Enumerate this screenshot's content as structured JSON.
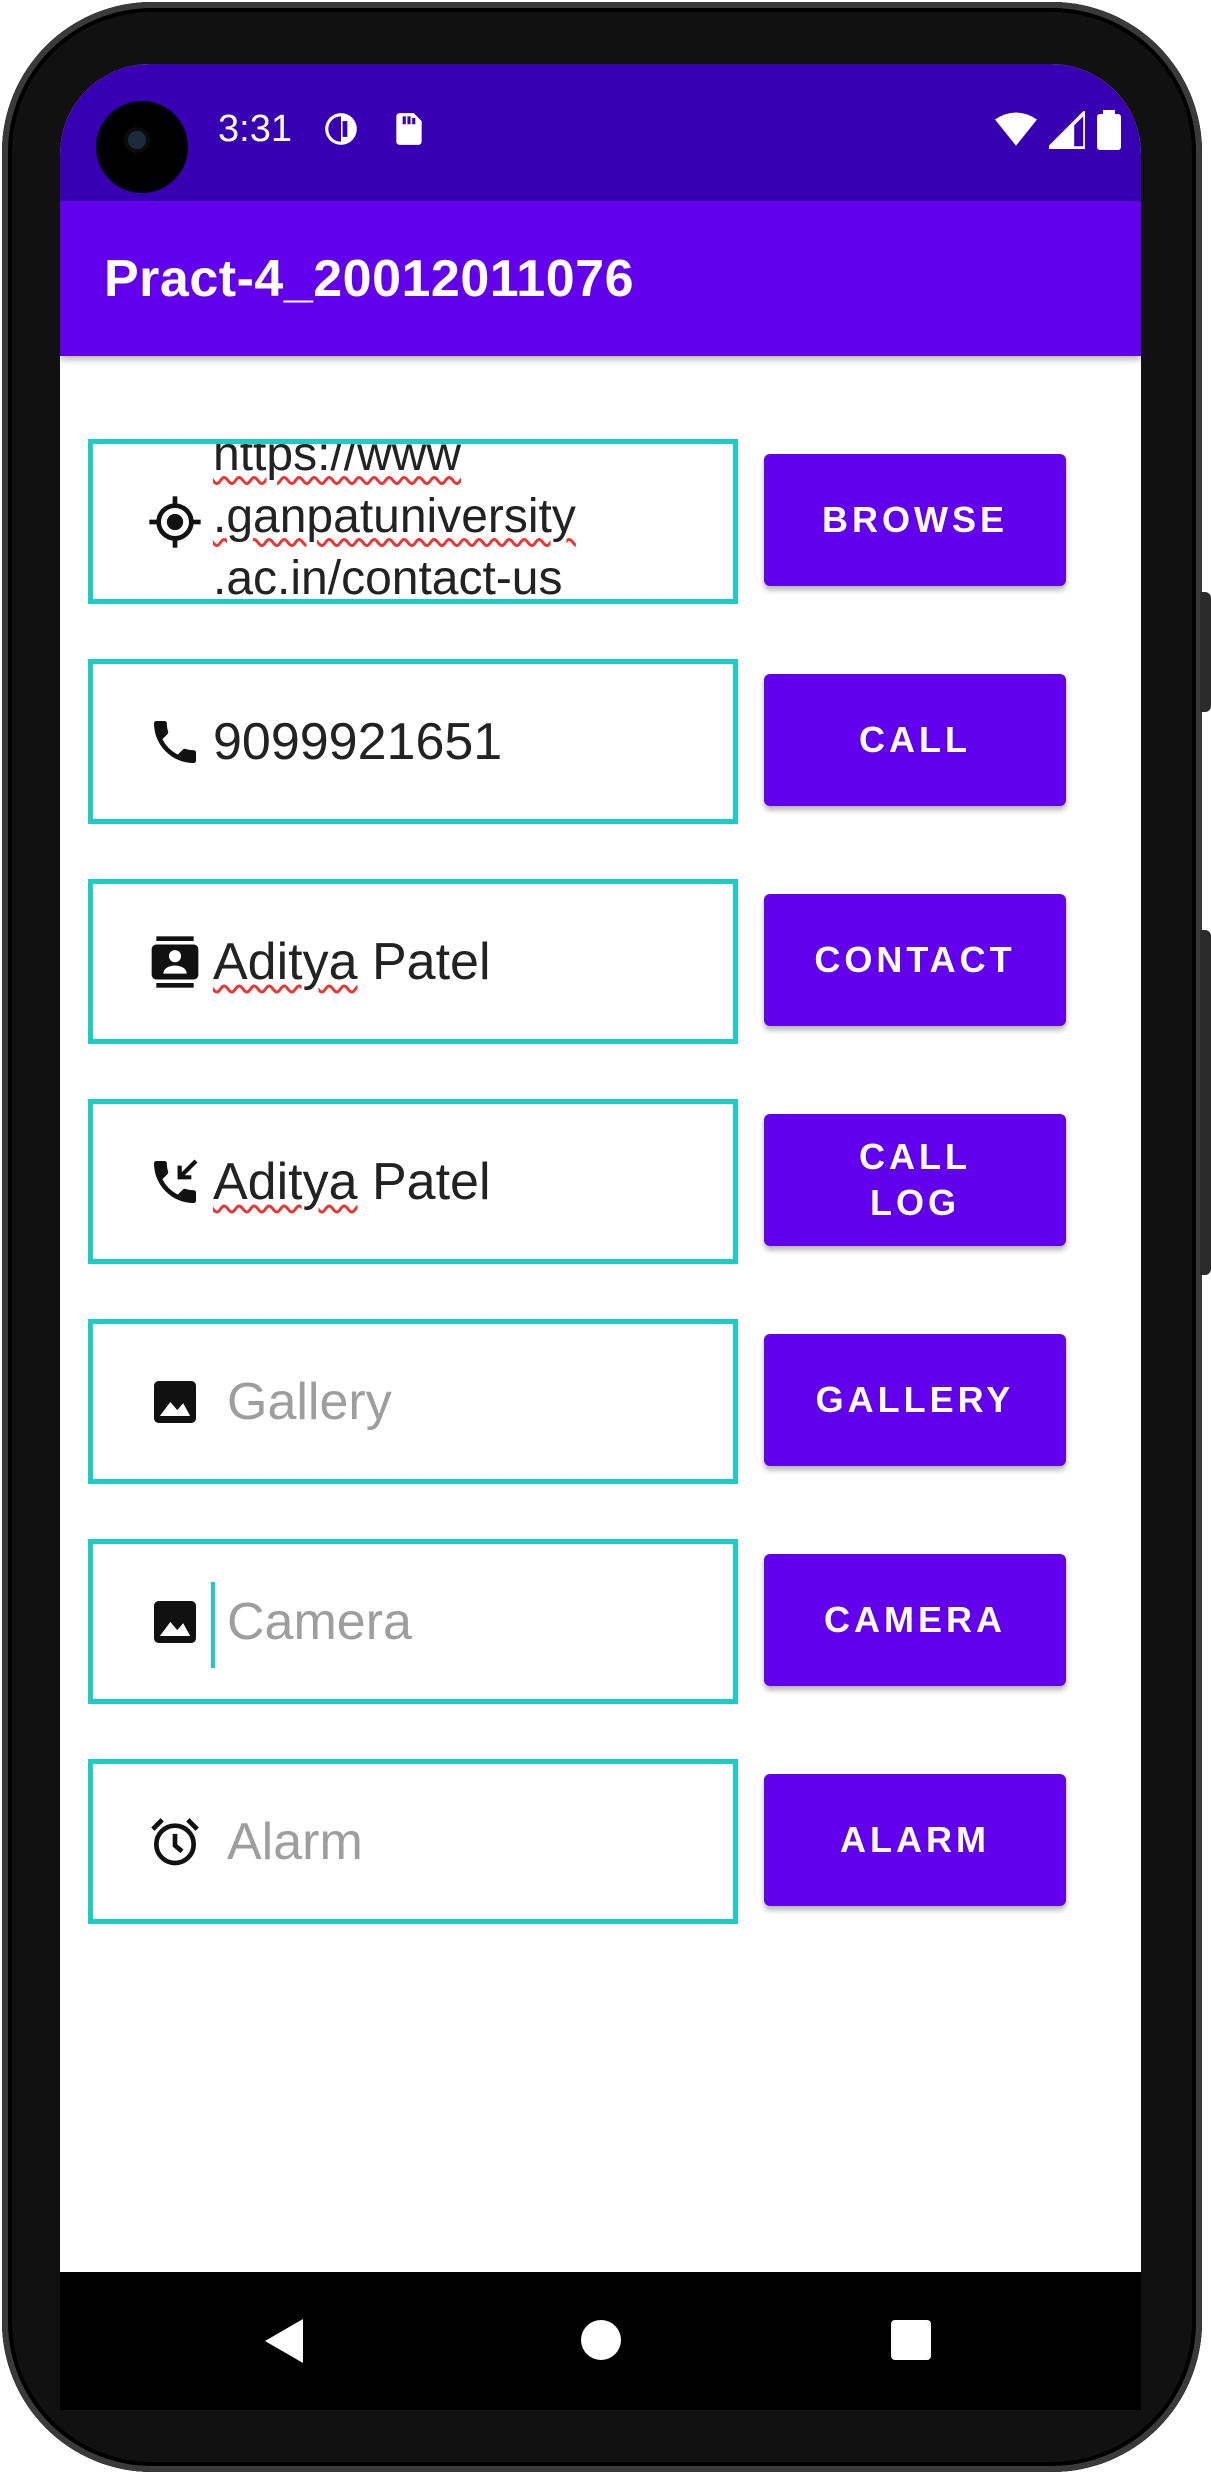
{
  "status_bar": {
    "time": "3:31",
    "icons_left": [
      "data-saver-icon",
      "sd-card-icon"
    ],
    "icons_right": [
      "wifi-icon",
      "signal-icon",
      "battery-icon"
    ]
  },
  "app_bar": {
    "title": "Pract-4_20012011076"
  },
  "colors": {
    "primary": "#6200EE",
    "primary_dark": "#3700B3",
    "field_border": "#1DCDC5",
    "spell_underline": "#e53935"
  },
  "rows": [
    {
      "icon": "location-target-icon",
      "value_lines": [
        "https://www",
        ".ganpatuniversity",
        ".ac.in/contact-us"
      ],
      "button": "BROWSE"
    },
    {
      "icon": "phone-icon",
      "value": "9099921651",
      "button": "CALL"
    },
    {
      "icon": "contact-card-icon",
      "value_word1": "Aditya",
      "value_word2": " Patel",
      "button": "CONTACT"
    },
    {
      "icon": "call-received-icon",
      "value_word1": "Aditya",
      "value_word2": " Patel",
      "button": "CALL\nLOG"
    },
    {
      "icon": "image-icon",
      "placeholder": "Gallery",
      "button": "GALLERY"
    },
    {
      "icon": "image-icon",
      "placeholder": "Camera",
      "button": "CAMERA"
    },
    {
      "icon": "alarm-icon",
      "placeholder": "Alarm",
      "button": "ALARM"
    }
  ],
  "nav_bar": {
    "buttons": [
      "back",
      "home",
      "recents"
    ]
  }
}
